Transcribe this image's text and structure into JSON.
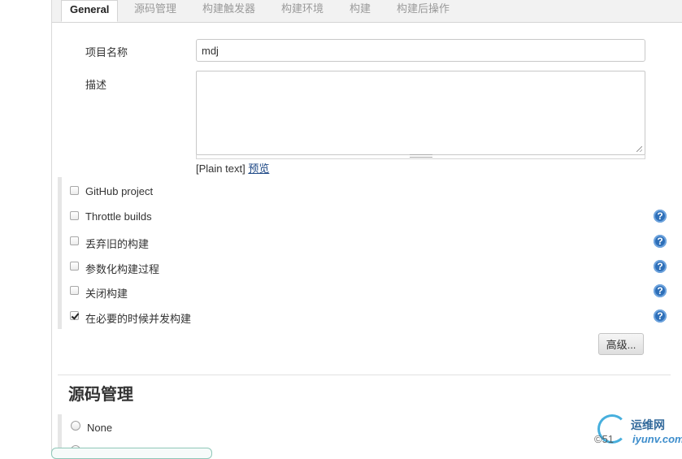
{
  "tabs": [
    {
      "label": "General"
    },
    {
      "label": "源码管理"
    },
    {
      "label": "构建触发器"
    },
    {
      "label": "构建环境"
    },
    {
      "label": "构建"
    },
    {
      "label": "构建后操作"
    }
  ],
  "form": {
    "project_name_label": "项目名称",
    "project_name_value": "mdj",
    "description_label": "描述",
    "description_value": "",
    "plain_text": "[Plain text]",
    "preview_link": "预览"
  },
  "options": [
    {
      "label": "GitHub project",
      "checked": false,
      "help": false
    },
    {
      "label": "Throttle builds",
      "checked": false,
      "help": true
    },
    {
      "label": "丢弃旧的构建",
      "checked": false,
      "help": true
    },
    {
      "label": "参数化构建过程",
      "checked": false,
      "help": true
    },
    {
      "label": "关闭构建",
      "checked": false,
      "help": true
    },
    {
      "label": "在必要的时候并发构建",
      "checked": true,
      "help": true
    }
  ],
  "help_glyph": "?",
  "advanced_button": "高级...",
  "scm_section": {
    "title": "源码管理",
    "radio_none": "None"
  },
  "watermark": {
    "title": "运维网",
    "prefix": "©51",
    "brand": "iyunv.com"
  },
  "colors": {
    "accent": "#2e6fb8",
    "link": "#204a87",
    "tab_inactive": "#9a9a9a"
  }
}
